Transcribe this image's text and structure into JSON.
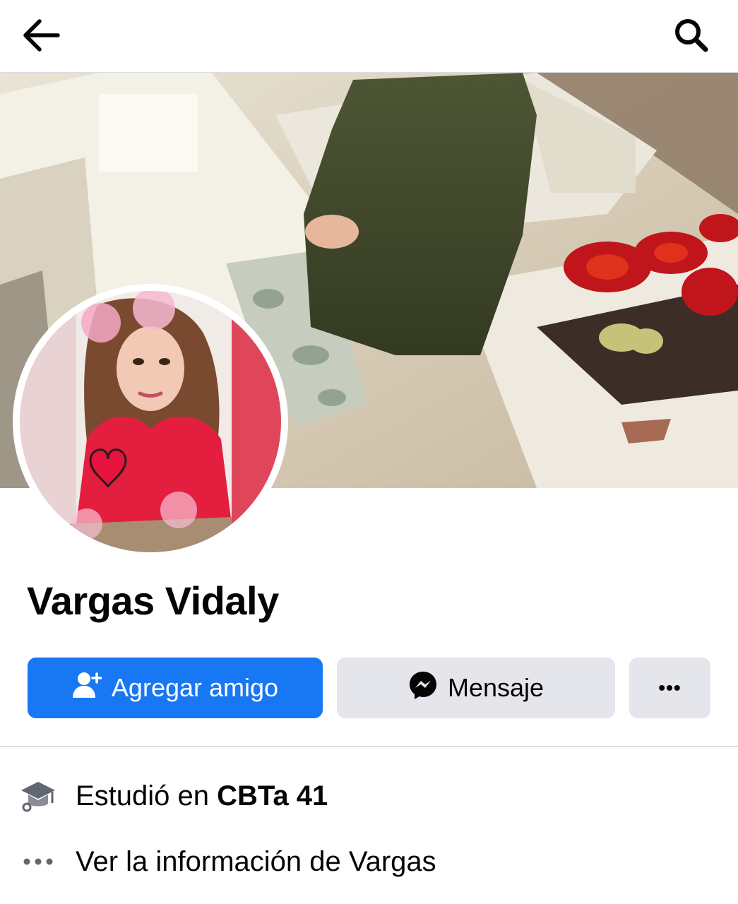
{
  "header": {
    "back_icon": "arrow-left-icon",
    "search_icon": "search-icon"
  },
  "profile": {
    "name": "Vargas Vidaly"
  },
  "actions": {
    "add_friend_label": "Agregar amigo",
    "add_friend_icon": "user-plus-icon",
    "message_label": "Mensaje",
    "message_icon": "messenger-icon",
    "more_label": "•••",
    "more_icon": "more-dots-icon"
  },
  "details": {
    "education_prefix": "Estudió en ",
    "education_school": "CBTa 41",
    "education_icon": "graduation-cap-icon",
    "info_link": "Ver la información de Vargas",
    "info_icon": "more-dots-icon"
  },
  "colors": {
    "primary": "#1877f2",
    "secondary_button": "#e4e6eb",
    "divider": "#dcdde0"
  }
}
